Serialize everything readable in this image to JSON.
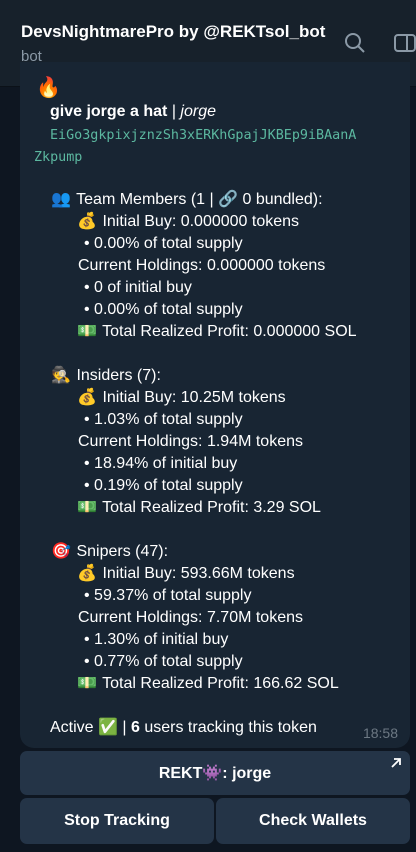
{
  "header": {
    "title": "DevsNightmarePro by @REKTsol_bot",
    "subtitle": "bot"
  },
  "message": {
    "fire": "🔥",
    "title_main": "give jorge a hat",
    "title_sep": " | ",
    "title_user": "jorge",
    "ca_line1": "EiGo3gkpixjznzSh3xERKhGpajJKBEp9iBAanA",
    "ca_line2": "Zkpump",
    "team": {
      "icon": "👥",
      "label": "Team Members (1 | 🔗 0 bundled):",
      "initial_buy": "Initial Buy: 0.000000 tokens",
      "initial_pct": "• 0.00% of total supply",
      "holdings": "Current Holdings: 0.000000 tokens",
      "holdings_init": "• 0 of initial buy",
      "holdings_pct": "• 0.00% of total supply",
      "profit": "Total Realized Profit: 0.000000 SOL"
    },
    "insiders": {
      "icon": "🕵",
      "label": "Insiders (7):",
      "initial_buy": "Initial Buy: 10.25M tokens",
      "initial_pct": "• 1.03% of total supply",
      "holdings": "Current Holdings: 1.94M tokens",
      "holdings_init": "• 18.94% of initial buy",
      "holdings_pct": "• 0.19% of total supply",
      "profit": "Total Realized Profit: 3.29 SOL"
    },
    "snipers": {
      "icon": "🎯",
      "label": "Snipers (47):",
      "initial_buy": "Initial Buy: 593.66M tokens",
      "initial_pct": "• 59.37% of total supply",
      "holdings": "Current Holdings: 7.70M tokens",
      "holdings_init": "• 1.30% of initial buy",
      "holdings_pct": "• 0.77% of total supply",
      "profit": "Total Realized Profit: 166.62 SOL"
    },
    "money_bag": "💰",
    "dollar": "💵",
    "status_word": "Active",
    "status_check": "✅",
    "status_sep": " | ",
    "users_count": "6",
    "users_text": " users tracking this token",
    "time": "18:58"
  },
  "keyboard": {
    "rekt_label": "REKT👾: jorge",
    "stop_label": "Stop Tracking",
    "check_label": "Check Wallets"
  }
}
